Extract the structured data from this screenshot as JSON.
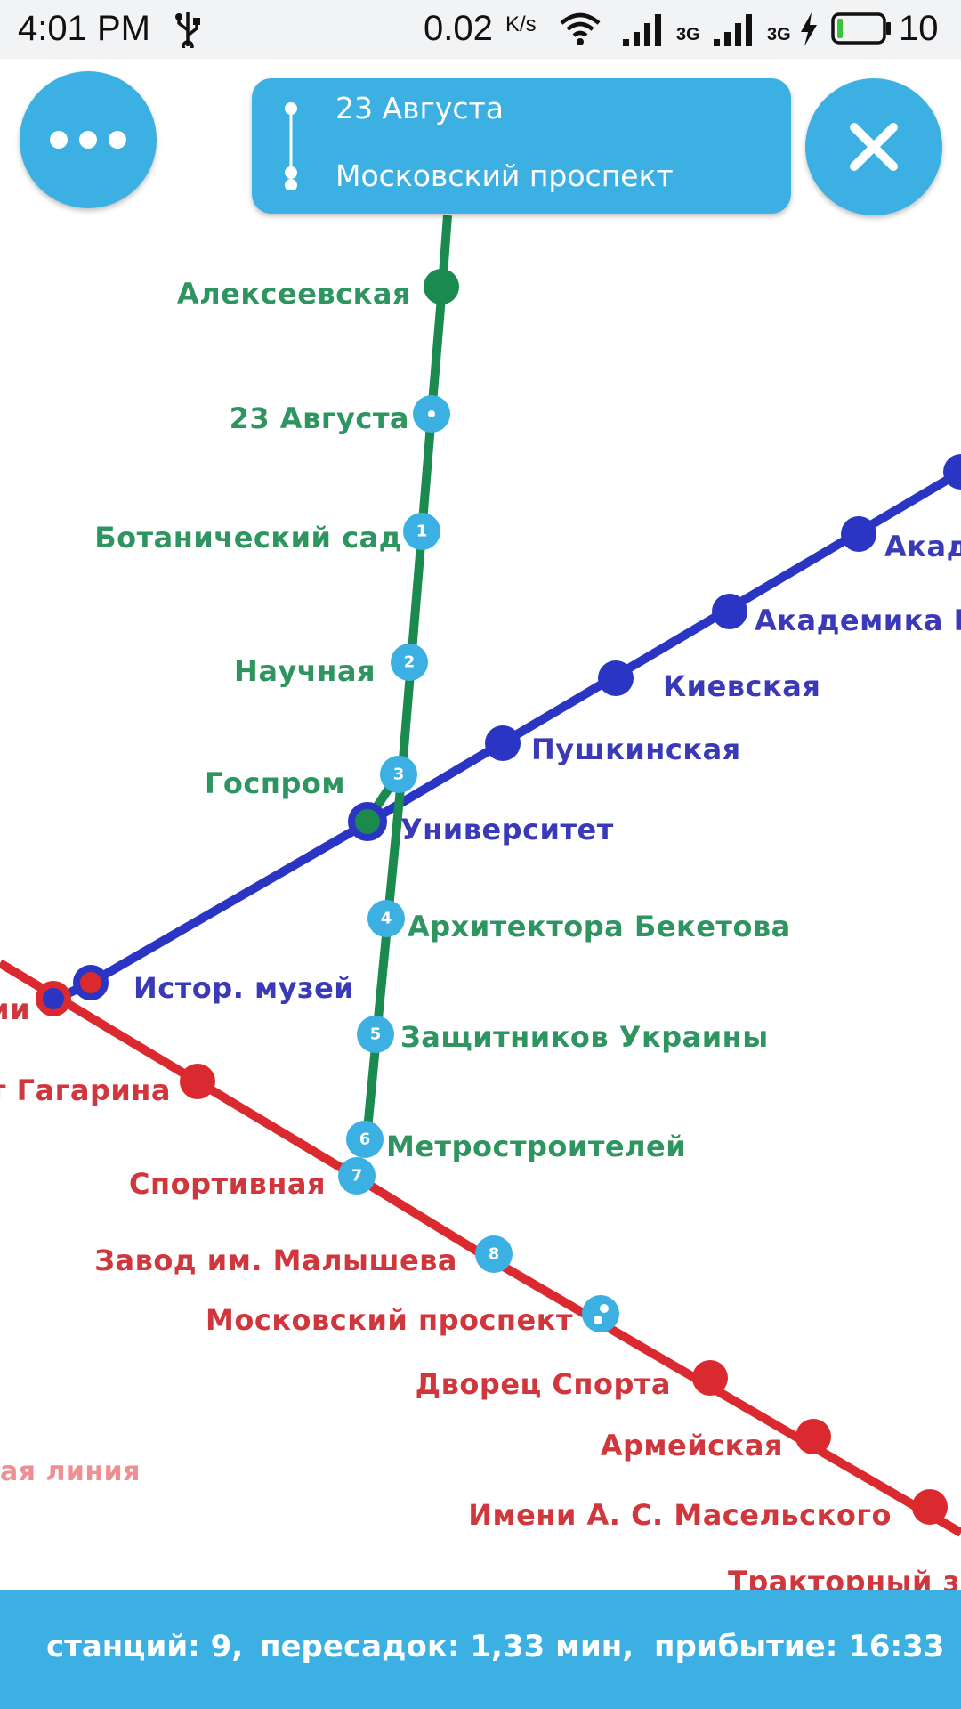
{
  "status_bar": {
    "time": "4:01 PM",
    "usb_icon": "usb-icon",
    "net_speed": "0.02",
    "net_unit": "K/s",
    "wifi_icon": "wifi-icon",
    "signal1_label": "3G",
    "signal2_label": "3G",
    "battery_level": "10"
  },
  "route_card": {
    "from": "23 Августа",
    "to": "Московский проспект"
  },
  "buttons": {
    "menu_icon": "more-horizontal-icon",
    "close_icon": "close-icon"
  },
  "map": {
    "colors": {
      "green": "#1a8a4f",
      "blue": "#2b35c4",
      "red": "#da2a2f",
      "route_stop": "#3db0e3"
    },
    "green_line": {
      "stations": [
        "Алексеевская",
        "23 Августа",
        "Ботанический сад",
        "Научная",
        "Госпром",
        "Архитектора Бекетова",
        "Защитников Украины",
        "Метростроителей"
      ],
      "route_numbers": [
        "1",
        "2",
        "3",
        "4",
        "5",
        "6"
      ]
    },
    "blue_line": {
      "stations": [
        "Акад",
        "Академика П",
        "Киевская",
        "Пушкинская",
        "Университет",
        "Истор. музей"
      ]
    },
    "red_line": {
      "stations": [
        "ии",
        "т Гагарина",
        "Спортивная",
        "Завод им. Малышева",
        "Московский проспект",
        "Дворец Спорта",
        "Армейская",
        "Имени А. С. Масельского",
        "Тракторный за"
      ],
      "route_numbers": [
        "7",
        "8"
      ],
      "line_name_fragment": "ая линия"
    }
  },
  "summary": {
    "stations": "станций: 9,",
    "transfers": "пересадок: 1,",
    "duration": "33 мин,",
    "arrival": "прибытие: 16:33"
  }
}
